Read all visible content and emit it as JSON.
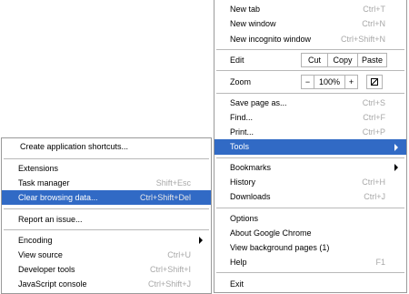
{
  "main_menu": {
    "new_tab": {
      "label": "New tab",
      "shortcut": "Ctrl+T"
    },
    "new_window": {
      "label": "New window",
      "shortcut": "Ctrl+N"
    },
    "new_incognito": {
      "label": "New incognito window",
      "shortcut": "Ctrl+Shift+N"
    },
    "edit": {
      "label": "Edit",
      "cut": "Cut",
      "copy": "Copy",
      "paste": "Paste"
    },
    "zoom": {
      "label": "Zoom",
      "minus": "−",
      "value": "100%",
      "plus": "+"
    },
    "save_page": {
      "label": "Save page as...",
      "shortcut": "Ctrl+S"
    },
    "find": {
      "label": "Find...",
      "shortcut": "Ctrl+F"
    },
    "print": {
      "label": "Print...",
      "shortcut": "Ctrl+P"
    },
    "tools": {
      "label": "Tools"
    },
    "bookmarks": {
      "label": "Bookmarks"
    },
    "history": {
      "label": "History",
      "shortcut": "Ctrl+H"
    },
    "downloads": {
      "label": "Downloads",
      "shortcut": "Ctrl+J"
    },
    "options": {
      "label": "Options"
    },
    "about": {
      "label": "About Google Chrome"
    },
    "background_pages": {
      "label": "View background pages (1)"
    },
    "help": {
      "label": "Help",
      "shortcut": "F1"
    },
    "exit": {
      "label": "Exit"
    }
  },
  "tools_menu": {
    "create_shortcuts": {
      "label": "Create application shortcuts..."
    },
    "extensions": {
      "label": "Extensions"
    },
    "task_manager": {
      "label": "Task manager",
      "shortcut": "Shift+Esc"
    },
    "clear_browsing": {
      "label": "Clear browsing data...",
      "shortcut": "Ctrl+Shift+Del"
    },
    "report_issue": {
      "label": "Report an issue..."
    },
    "encoding": {
      "label": "Encoding"
    },
    "view_source": {
      "label": "View source",
      "shortcut": "Ctrl+U"
    },
    "developer_tools": {
      "label": "Developer tools",
      "shortcut": "Ctrl+Shift+I"
    },
    "javascript_console": {
      "label": "JavaScript console",
      "shortcut": "Ctrl+Shift+J"
    }
  },
  "colors": {
    "highlight": "#316ac5",
    "shortcut_text": "#a8a8a8",
    "border": "#9a9a9a"
  },
  "icons": {
    "submenu_arrow": "right-triangle",
    "fullscreen": "fullscreen-box"
  }
}
